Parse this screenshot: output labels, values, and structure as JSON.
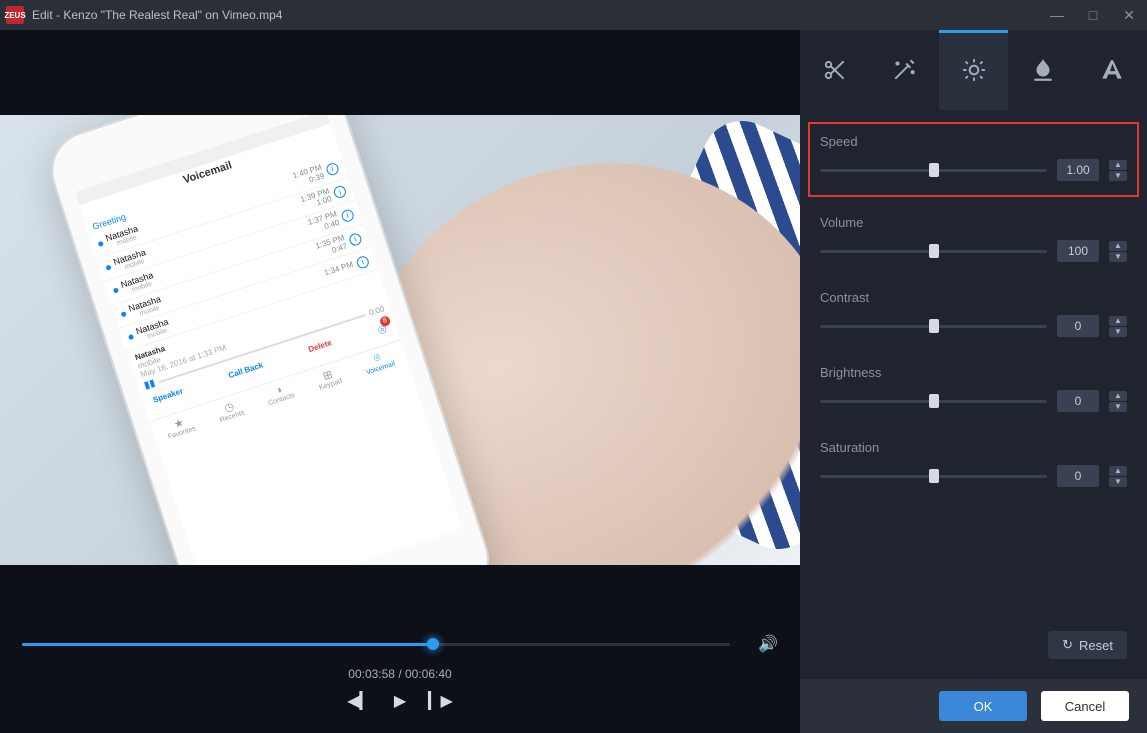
{
  "title": "Edit - Kenzo \"The Realest Real\" on Vimeo.mp4",
  "app_icon_text": "ZEUS",
  "phone": {
    "header": "Voicemail",
    "tab_label": "Greeting",
    "rows": [
      {
        "name": "Natasha",
        "sub": "mobile",
        "time": "1:40 PM",
        "date": "0:39"
      },
      {
        "name": "Natasha",
        "sub": "mobile",
        "time": "1:39 PM",
        "date": "1:00"
      },
      {
        "name": "Natasha",
        "sub": "mobile",
        "time": "1:37 PM",
        "date": "0:40"
      },
      {
        "name": "Natasha",
        "sub": "mobile",
        "time": "1:35 PM",
        "date": "0:47"
      },
      {
        "name": "Natasha",
        "sub": "mobile",
        "time": "1:34 PM",
        "date": ""
      }
    ],
    "detail": {
      "name": "Natasha",
      "sub": "mobile",
      "date": "May 16, 2016 at 1:33 PM"
    },
    "actions": {
      "speaker": "Speaker",
      "callback": "Call Back",
      "del": "Delete"
    },
    "time_scrub": "0:00",
    "bottom_tabs": [
      "Favorites",
      "Recents",
      "Contacts",
      "Keypad",
      "Voicemail"
    ]
  },
  "player": {
    "progress_pct": 58,
    "current": "00:03:58",
    "total": "00:06:40"
  },
  "right_tabs": [
    "cut",
    "effects",
    "adjust",
    "watermark",
    "text"
  ],
  "right_tab_active": 2,
  "props": [
    {
      "key": "speed",
      "label": "Speed",
      "value": "1.00",
      "pos": 50,
      "highlight": true
    },
    {
      "key": "volume",
      "label": "Volume",
      "value": "100",
      "pos": 50,
      "highlight": false
    },
    {
      "key": "contrast",
      "label": "Contrast",
      "value": "0",
      "pos": 50,
      "highlight": false
    },
    {
      "key": "brightness",
      "label": "Brightness",
      "value": "0",
      "pos": 50,
      "highlight": false
    },
    {
      "key": "saturation",
      "label": "Saturation",
      "value": "0",
      "pos": 50,
      "highlight": false
    }
  ],
  "reset_label": "Reset",
  "ok_label": "OK",
  "cancel_label": "Cancel"
}
